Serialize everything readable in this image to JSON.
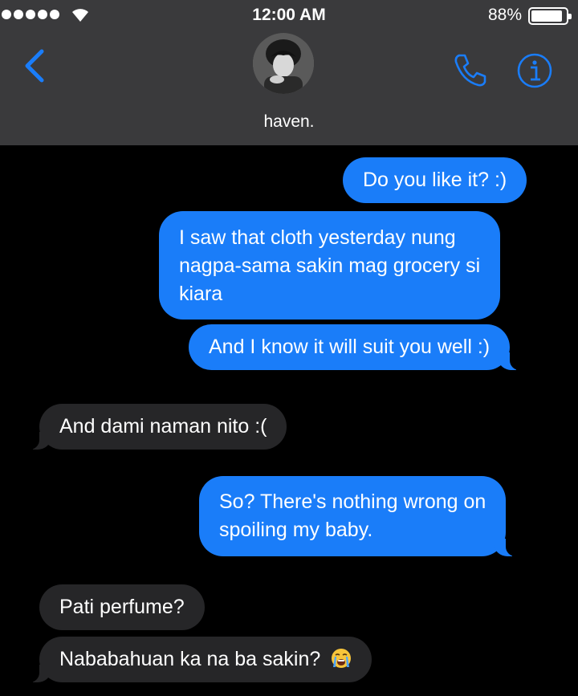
{
  "status_bar": {
    "time": "12:00 AM",
    "battery": "88%"
  },
  "contact": {
    "name": "haven."
  },
  "messages": [
    {
      "from": "me",
      "text": "Do you like it? :)"
    },
    {
      "from": "me",
      "lines": [
        "I saw that cloth yesterday nung",
        "nagpa-sama sakin mag grocery si",
        "kiara"
      ]
    },
    {
      "from": "me",
      "text": "And I know it will suit you well :)"
    },
    {
      "from": "them",
      "text": "And dami naman nito :("
    },
    {
      "from": "me",
      "lines": [
        "So? There's nothing wrong on",
        "spoiling my baby."
      ]
    },
    {
      "from": "them",
      "text": "Pati perfume?"
    },
    {
      "from": "them",
      "text": "Nababahuan ka na ba sakin?",
      "emoji": "loudly-crying-face"
    }
  ],
  "colors": {
    "sent": "#1a7df9",
    "received": "#262628",
    "accent": "#1a7df9",
    "header": "#3a3a3c"
  }
}
